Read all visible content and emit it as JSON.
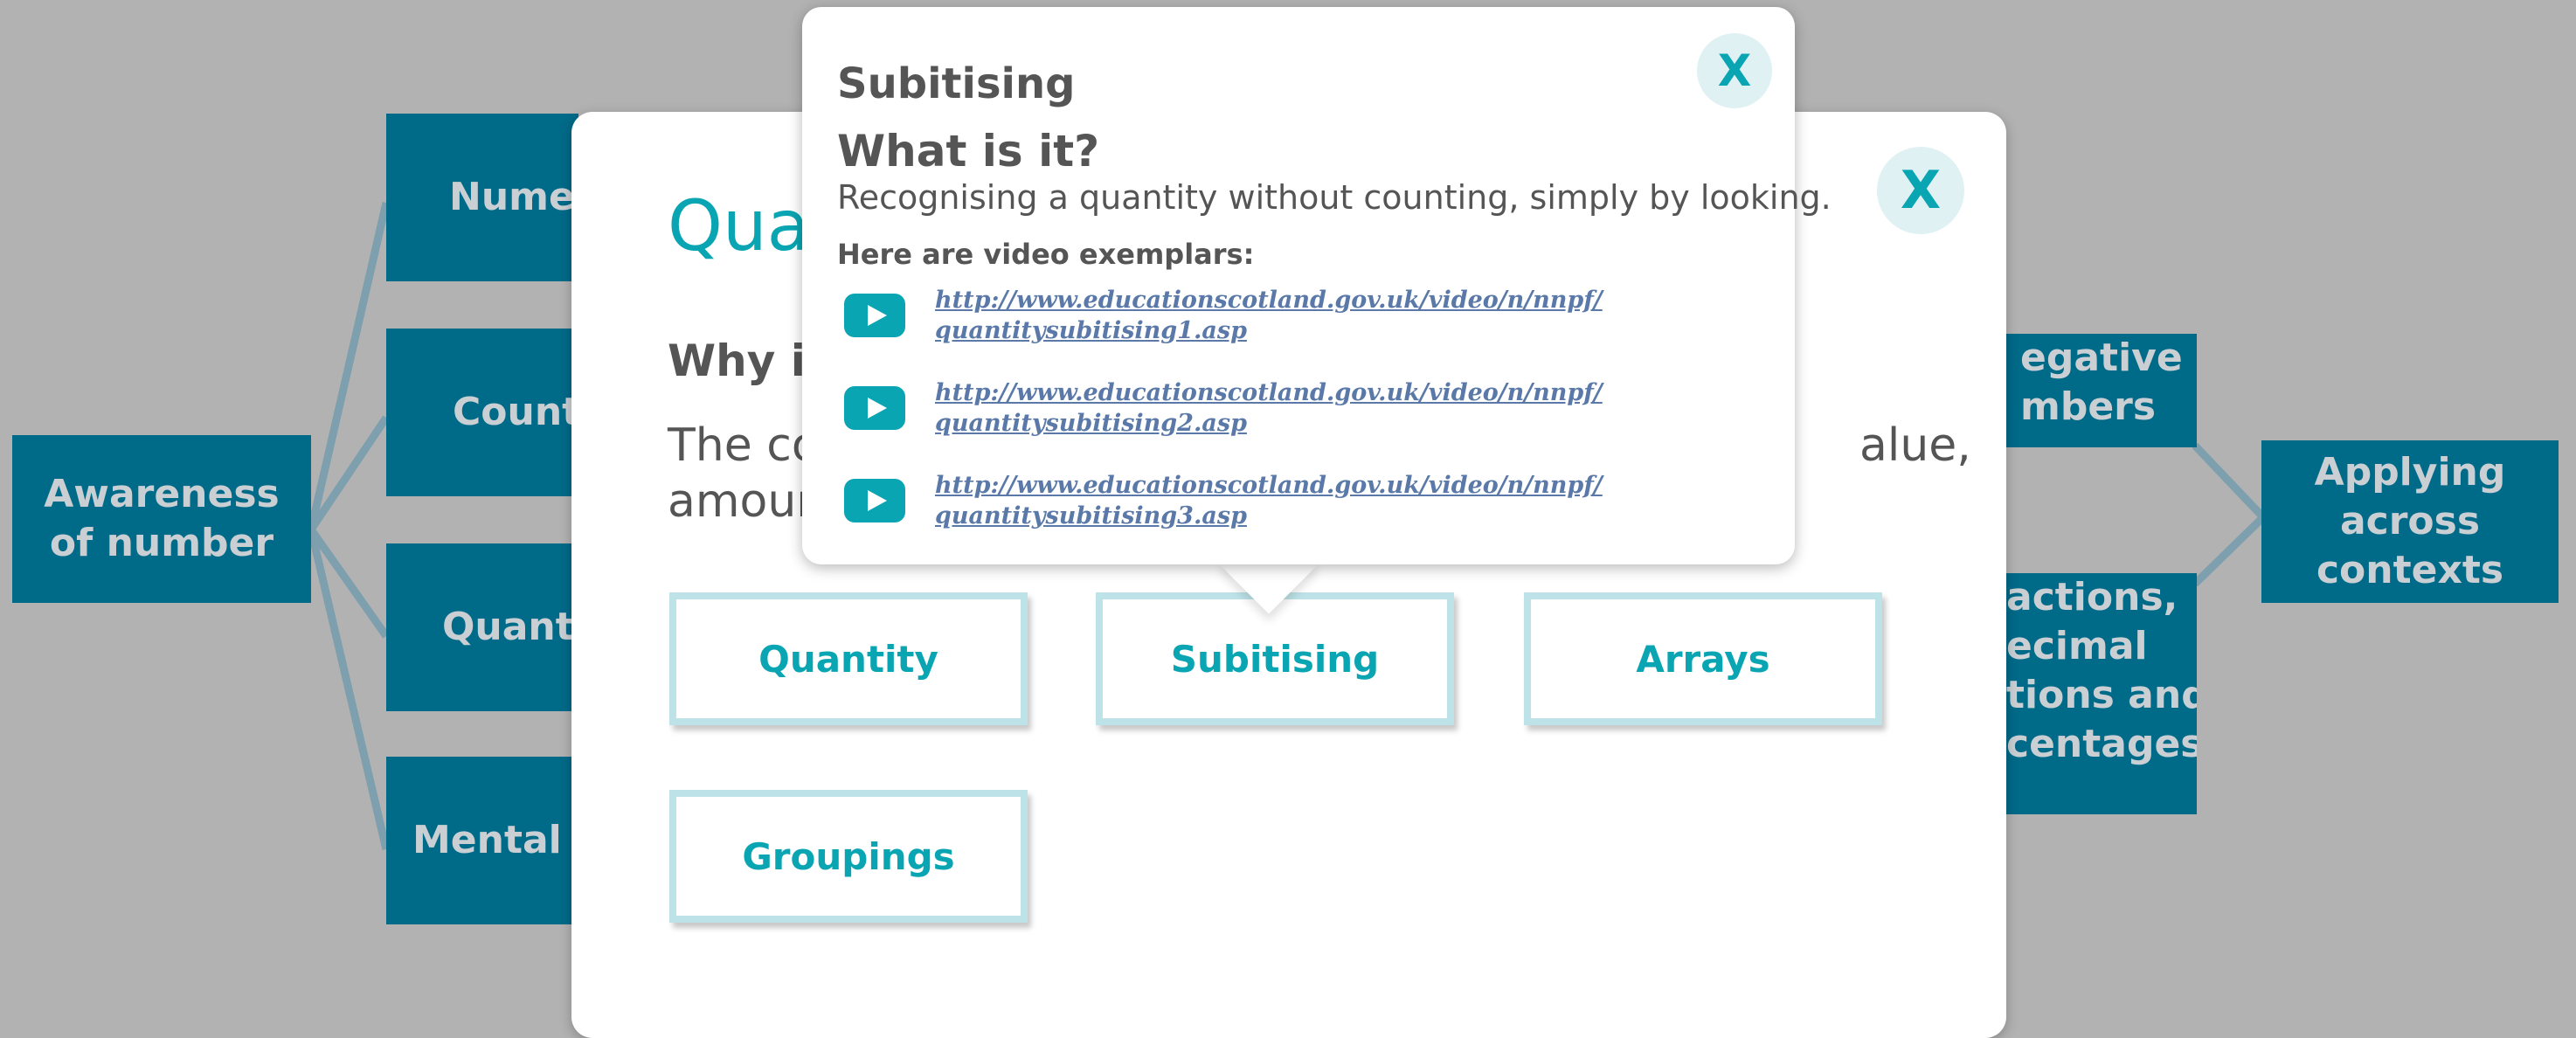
{
  "map": {
    "awareness": "Awareness of number",
    "left_items": [
      "Numer",
      "Counti",
      "Quantit",
      "Mental ag"
    ],
    "right_items": {
      "negative_line1": "egative",
      "negative_line2": "mbers",
      "fractions": [
        "actions,",
        "ecimal",
        "tions and",
        "centages"
      ],
      "applying": "Applying across contexts"
    },
    "box_color": "#006a89"
  },
  "modal": {
    "title": "Quar",
    "subtitle": "Why is",
    "body_line1": "The co",
    "body_line1_end": "alue,",
    "body_line2": "amoun",
    "close_label": "X",
    "cards": [
      "Quantity",
      "Subitising",
      "Arrays",
      "Groupings"
    ],
    "accent_color": "#0aa5b2"
  },
  "popover": {
    "title": "Subitising",
    "heading": "What is it?",
    "description": "Recognising a quantity without counting, simply by looking.",
    "label": "Here are video exemplars:",
    "close_label": "X",
    "videos": [
      {
        "line1": "http://www.educationscotland.gov.uk/video/n/nnpf/",
        "line2": "quantitysubitising1.asp"
      },
      {
        "line1": "http://www.educationscotland.gov.uk/video/n/nnpf/",
        "line2": "quantitysubitising2.asp"
      },
      {
        "line1": "http://www.educationscotland.gov.uk/video/n/nnpf/",
        "line2": "quantitysubitising3.asp"
      }
    ],
    "icons": {
      "video": "play-icon",
      "close": "close-icon"
    }
  }
}
